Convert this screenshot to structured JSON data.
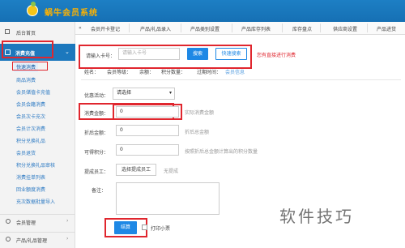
{
  "app": {
    "title": "蜗牛会员系统"
  },
  "sidebar": {
    "home": "后台首页",
    "group": "消费充值",
    "items": [
      {
        "label": "快速消费"
      },
      {
        "label": "商品消费"
      },
      {
        "label": "会员储值卡充值"
      },
      {
        "label": "会员会籍消费"
      },
      {
        "label": "会员次卡充次"
      },
      {
        "label": "会员计次消费"
      },
      {
        "label": "积分兑换礼品"
      },
      {
        "label": "会员退货"
      },
      {
        "label": "积分兑换礼品审核"
      },
      {
        "label": "消费挂单列表"
      },
      {
        "label": "回业额度消费"
      },
      {
        "label": "充次数据批量导入"
      }
    ],
    "bottom": [
      {
        "label": "会员管理",
        "icon": "user-icon"
      },
      {
        "label": "产品/礼品管理",
        "icon": "box-icon"
      }
    ]
  },
  "tabs": [
    {
      "label": "会员开卡登记"
    },
    {
      "label": "产品/礼品录入"
    },
    {
      "label": "产品类别设置"
    },
    {
      "label": "产品库存列表"
    },
    {
      "label": "库存盘点"
    },
    {
      "label": "供应商设置"
    },
    {
      "label": "产品进货"
    }
  ],
  "search": {
    "label": "请输入卡号：",
    "placeholder": "请输入卡号",
    "search_btn": "搜索",
    "fast_btn": "快速搜索",
    "note": "您有直接进行消费"
  },
  "member_info": {
    "fields": [
      "姓名：",
      "会员等级：",
      "余额：",
      "积分数量：",
      "过期时间："
    ],
    "status": "会员信息"
  },
  "form": {
    "promo_label": "优惠活动：",
    "promo_value": "请选择",
    "amount_label": "消费金额：",
    "amount_value": "0",
    "amount_hint": "实际消费金额",
    "discount_label": "折后金额：",
    "discount_value": "0",
    "discount_hint": "折后总金额",
    "points_label": "可得积分：",
    "points_value": "0",
    "points_hint": "按照折后总金额计算出的积分数量",
    "staff_label": "提成员工：",
    "staff_btn": "选择提成员工",
    "staff_hint": "无提成",
    "note_label": "备注：",
    "submit_btn": "结算",
    "print_label": "打印小票"
  },
  "watermark": "软件技巧",
  "colors": {
    "header": "#1670b4",
    "accent": "#1e88e5",
    "highlight": "#e0262e",
    "title": "#ffb300"
  }
}
